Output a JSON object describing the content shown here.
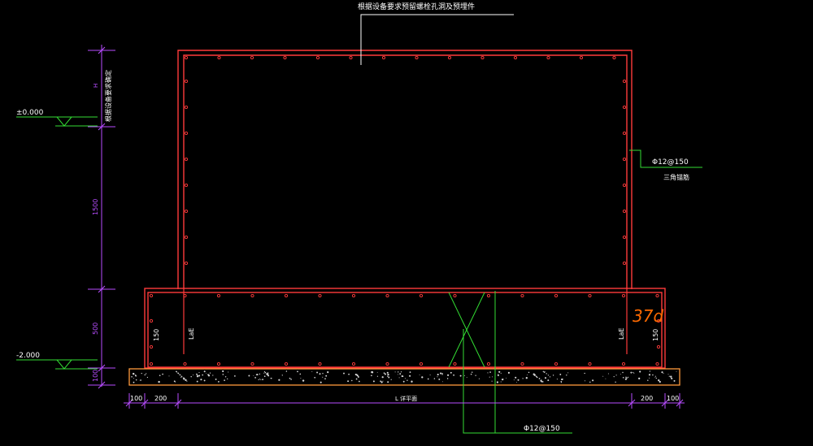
{
  "drawing": {
    "top_note": "根据设备要求预留螺栓孔洞及预埋件",
    "height_note": "H",
    "height_note2": "根据设备要求确定",
    "levels": [
      "±0.000",
      "-2.000"
    ],
    "vertical_dims": [
      "1500",
      "500",
      "100"
    ],
    "horizontal_dims": [
      "100",
      "200",
      "L 详平面",
      "200",
      "100"
    ],
    "wall_rebar": "Φ12@150",
    "wall_rebar_note": "三角锚筋",
    "bottom_rebar": "Φ12@150",
    "lae_left": "LaE",
    "lae_right": "LaE",
    "dim_150_left": "150",
    "dim_150_right": "150",
    "handwritten_note": "37d"
  },
  "colors": {
    "background": "#000000",
    "outline": "#ff3b3b",
    "rebar_dots": "#ff3b3b",
    "concrete": "#ff9a3c",
    "leader": "#33dd33",
    "dimension": "#b84dff",
    "text": "#ffffff",
    "handwriting": "#ff6a00"
  }
}
